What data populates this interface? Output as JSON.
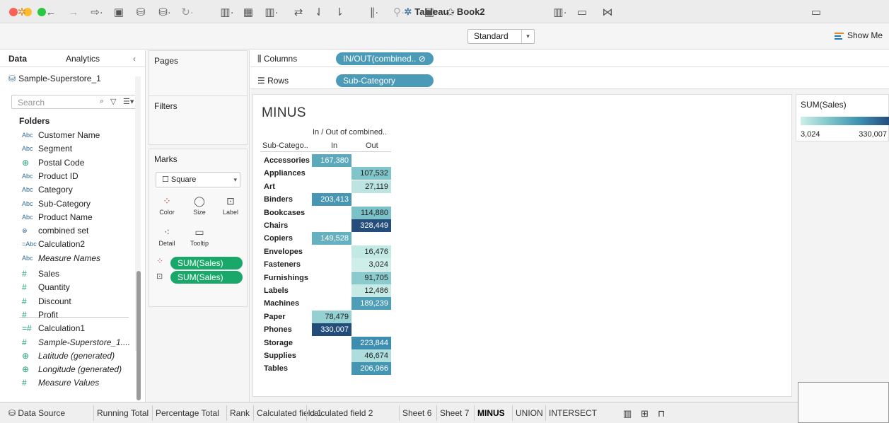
{
  "window": {
    "title": "Tableau - Book2"
  },
  "toolbar": {
    "mark_size": "Standard",
    "show_me": "Show Me"
  },
  "left_panel": {
    "tab_data": "Data",
    "tab_analytics": "Analytics",
    "datasource": "Sample-Superstore_1",
    "search_placeholder": "Search",
    "folders_label": "Folders",
    "fields": [
      {
        "type": "Abc",
        "name": "Customer Name",
        "italic": false
      },
      {
        "type": "Abc",
        "name": "Segment",
        "italic": false
      },
      {
        "type": "geo",
        "name": "Postal Code",
        "italic": false
      },
      {
        "type": "Abc",
        "name": "Product ID",
        "italic": false
      },
      {
        "type": "Abc",
        "name": "Category",
        "italic": false
      },
      {
        "type": "Abc",
        "name": "Sub-Category",
        "italic": false
      },
      {
        "type": "Abc",
        "name": "Product Name",
        "italic": false
      },
      {
        "type": "set",
        "name": "combined set",
        "italic": false
      },
      {
        "type": "=Abc",
        "name": "Calculation2",
        "italic": false
      },
      {
        "type": "Abc",
        "name": "Measure Names",
        "italic": true
      }
    ],
    "measures": [
      {
        "type": "#",
        "name": "Sales",
        "italic": false
      },
      {
        "type": "#",
        "name": "Quantity",
        "italic": false
      },
      {
        "type": "#",
        "name": "Discount",
        "italic": false
      },
      {
        "type": "#",
        "name": "Profit",
        "italic": false
      },
      {
        "type": "=#",
        "name": "Calculation1",
        "italic": false
      },
      {
        "type": "#",
        "name": "Sample-Superstore_1....",
        "italic": true
      },
      {
        "type": "geo",
        "name": "Latitude (generated)",
        "italic": true
      },
      {
        "type": "geo",
        "name": "Longitude (generated)",
        "italic": true
      },
      {
        "type": "#",
        "name": "Measure Values",
        "italic": true
      }
    ]
  },
  "cards": {
    "pages": "Pages",
    "filters": "Filters",
    "marks": "Marks",
    "mark_type": "Square",
    "buttons": {
      "color": "Color",
      "size": "Size",
      "label": "Label",
      "detail": "Detail",
      "tooltip": "Tooltip"
    },
    "pill_color": "SUM(Sales)",
    "pill_label": "SUM(Sales)"
  },
  "shelves": {
    "columns_label": "Columns",
    "columns_pill": "IN/OUT(combined..",
    "rows_label": "Rows",
    "rows_pill": "Sub-Category"
  },
  "view": {
    "title": "MINUS",
    "header_top": "In / Out of combined..",
    "row_header": "Sub-Catego..",
    "col_in": "In",
    "col_out": "Out",
    "rows": [
      {
        "name": "Accessories",
        "in": "167,380",
        "in_val": 167380,
        "out": "",
        "out_val": null
      },
      {
        "name": "Appliances",
        "in": "",
        "in_val": null,
        "out": "107,532",
        "out_val": 107532
      },
      {
        "name": "Art",
        "in": "",
        "in_val": null,
        "out": "27,119",
        "out_val": 27119
      },
      {
        "name": "Binders",
        "in": "203,413",
        "in_val": 203413,
        "out": "",
        "out_val": null
      },
      {
        "name": "Bookcases",
        "in": "",
        "in_val": null,
        "out": "114,880",
        "out_val": 114880
      },
      {
        "name": "Chairs",
        "in": "",
        "in_val": null,
        "out": "328,449",
        "out_val": 328449
      },
      {
        "name": "Copiers",
        "in": "149,528",
        "in_val": 149528,
        "out": "",
        "out_val": null
      },
      {
        "name": "Envelopes",
        "in": "",
        "in_val": null,
        "out": "16,476",
        "out_val": 16476
      },
      {
        "name": "Fasteners",
        "in": "",
        "in_val": null,
        "out": "3,024",
        "out_val": 3024
      },
      {
        "name": "Furnishings",
        "in": "",
        "in_val": null,
        "out": "91,705",
        "out_val": 91705
      },
      {
        "name": "Labels",
        "in": "",
        "in_val": null,
        "out": "12,486",
        "out_val": 12486
      },
      {
        "name": "Machines",
        "in": "",
        "in_val": null,
        "out": "189,239",
        "out_val": 189239
      },
      {
        "name": "Paper",
        "in": "78,479",
        "in_val": 78479,
        "out": "",
        "out_val": null
      },
      {
        "name": "Phones",
        "in": "330,007",
        "in_val": 330007,
        "out": "",
        "out_val": null
      },
      {
        "name": "Storage",
        "in": "",
        "in_val": null,
        "out": "223,844",
        "out_val": 223844
      },
      {
        "name": "Supplies",
        "in": "",
        "in_val": null,
        "out": "46,674",
        "out_val": 46674
      },
      {
        "name": "Tables",
        "in": "",
        "in_val": null,
        "out": "206,966",
        "out_val": 206966
      }
    ]
  },
  "legend": {
    "title": "SUM(Sales)",
    "min_label": "3,024",
    "max_label": "330,007",
    "min": 3024,
    "max": 330007
  },
  "bottom_tabs": [
    "Data Source",
    "Running Total",
    "Percentage Total",
    "Rank",
    "Calculated field 1",
    "calculated field 2",
    "Sheet 6",
    "Sheet 7",
    "MINUS",
    "UNION",
    "INTERSECT"
  ],
  "active_tab": "MINUS"
}
